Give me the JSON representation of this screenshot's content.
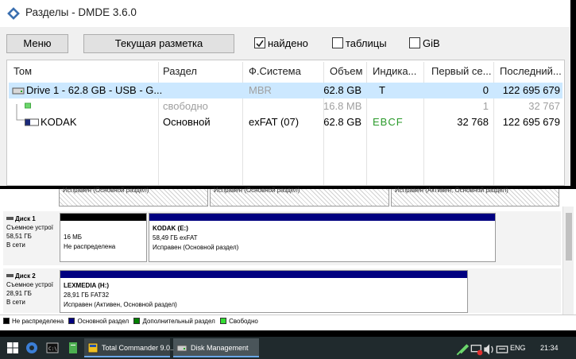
{
  "window": {
    "title": "Разделы - DMDE 3.6.0"
  },
  "toolbar": {
    "menu_label": "Меню",
    "layout_label": "Текущая разметка",
    "found_label": "найдено",
    "tables_label": "таблицы",
    "gib_label": "GiB",
    "found_checked": true,
    "tables_checked": false,
    "gib_checked": false
  },
  "table": {
    "headers": [
      "Том",
      "Раздел",
      "Ф.Система",
      "Объем",
      "Индика...",
      "Первый се...",
      "Последний..."
    ],
    "rows": [
      {
        "volume": "Drive 1 - 62.8 GB - USB - G...",
        "partition": "",
        "fs": "MBR",
        "size": "62.8 GB",
        "indicator": "T",
        "first": "0",
        "last": "122 695 679"
      },
      {
        "volume": "",
        "partition": "свободно",
        "fs": "",
        "size": "16.8 MB",
        "indicator": "",
        "first": "1",
        "last": "32 767"
      },
      {
        "volume": "KODAK",
        "partition": "Основной",
        "fs": "exFAT (07)",
        "size": "62.8 GB",
        "indicator": "EBCF",
        "first": "32 768",
        "last": "122 695 679"
      }
    ]
  },
  "disk_management": {
    "top_strip": [
      "Исправен (Основной раздел)",
      "Исправен (Основной раздел)",
      "Исправен (Активен, Основной раздел)"
    ],
    "disks": [
      {
        "name": "Диск 1",
        "type": "Съемное устрої",
        "size": "58,51 ГБ",
        "status": "В сети",
        "volumes": [
          {
            "line1": "",
            "line2": "16 МБ",
            "line3": "Не распределена",
            "bar_color": "#000000"
          },
          {
            "line1": "KODAK  (E:)",
            "line2": "58,49 ГБ exFAT",
            "line3": "Исправен (Основной раздел)",
            "bar_color": "#000080"
          }
        ]
      },
      {
        "name": "Диск 2",
        "type": "Съемное устрої",
        "size": "28,91 ГБ",
        "status": "В сети",
        "volumes": [
          {
            "line1": "LEXMEDIA  (H:)",
            "line2": "28,91 ГБ FAT32",
            "line3": "Исправен (Активен, Основной раздел)",
            "bar_color": "#000080"
          }
        ]
      }
    ],
    "legend": [
      {
        "label": "Не распределена",
        "color": "#000000"
      },
      {
        "label": "Основной раздел",
        "color": "#000080"
      },
      {
        "label": "Дополнительный раздел",
        "color": "#008000"
      },
      {
        "label": "Свободно",
        "color": "#33dd33"
      }
    ]
  },
  "taskbar": {
    "tasks": [
      {
        "label": "Total Commander 9.0...",
        "icon": "total-commander-icon"
      },
      {
        "label": "Disk Management",
        "icon": "disk-management-icon"
      }
    ],
    "language": "ENG",
    "time": "21:34"
  }
}
